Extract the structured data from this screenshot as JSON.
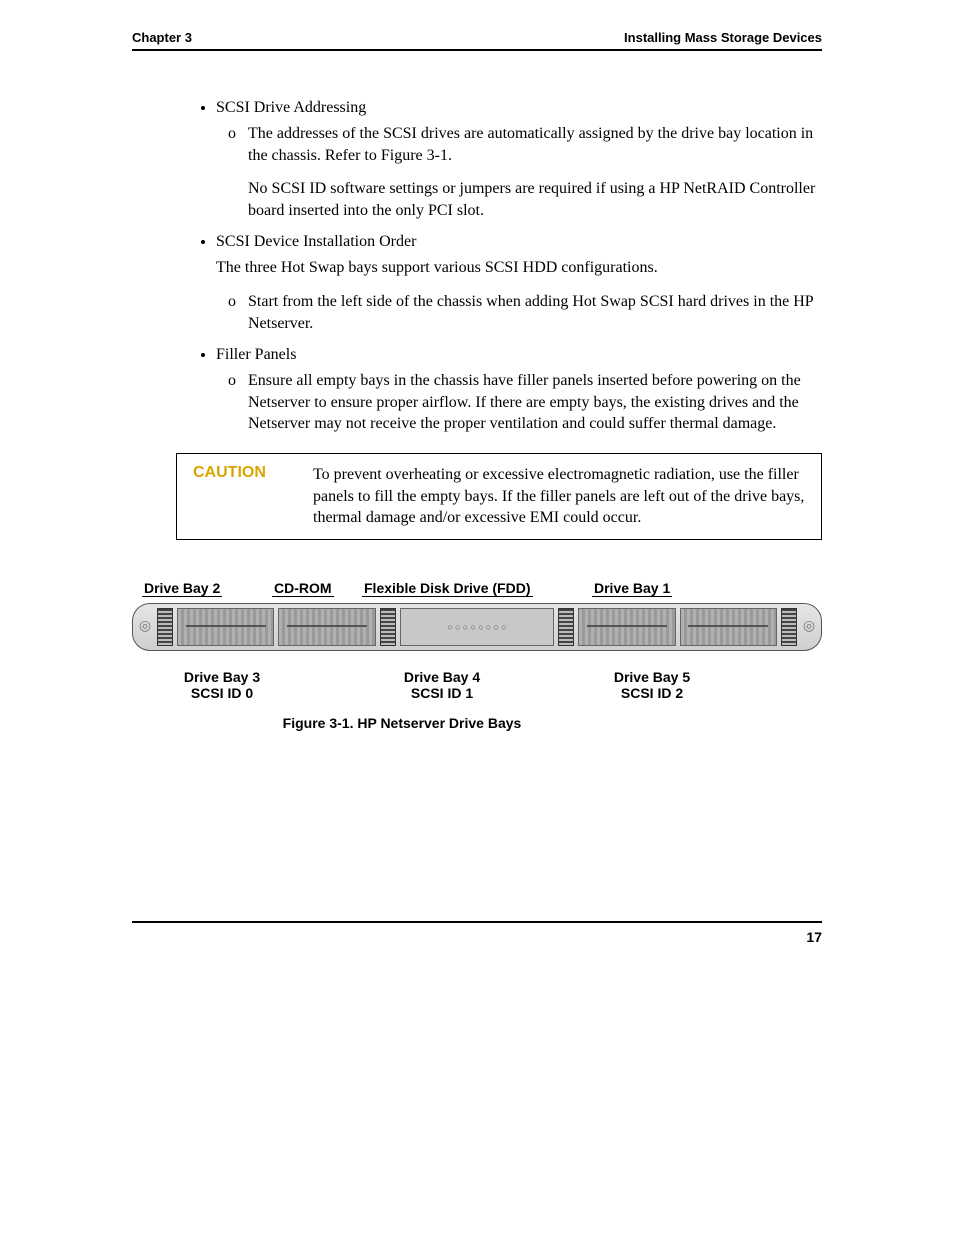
{
  "header": {
    "left": "Chapter 3",
    "right": "Installing Mass Storage Devices"
  },
  "list": {
    "item1": {
      "title": "SCSI Drive Addressing",
      "sub1": "The addresses of the SCSI drives are automatically assigned by the drive bay location in the chassis. Refer to Figure 3-1.",
      "note": "No SCSI ID software settings or jumpers are required if using a HP NetRAID Controller board inserted into the only PCI slot."
    },
    "item2": {
      "title": "SCSI Device Installation Order",
      "para": "The three Hot Swap bays support various SCSI HDD configurations.",
      "sub1": "Start from the left side of the chassis when adding Hot Swap SCSI hard drives in the HP Netserver."
    },
    "item3": {
      "title": "Filler Panels",
      "sub1": "Ensure all empty bays in the chassis have filler panels inserted before powering on the Netserver to ensure proper airflow. If there are empty bays, the existing drives and the Netserver may not receive the proper ventilation and could suffer thermal damage."
    }
  },
  "caution": {
    "label": "CAUTION",
    "text": "To prevent overheating or excessive electromagnetic radiation, use the filler panels to fill the empty bays. If the filler panels are left out of the drive bays, thermal damage and/or excessive EMI could occur."
  },
  "figure": {
    "top": {
      "bay2": "Drive Bay 2",
      "cdrom": "CD-ROM",
      "fdd": "Flexible Disk Drive (FDD)",
      "bay1": "Drive Bay 1"
    },
    "bottom": {
      "bay3_l1": "Drive Bay 3",
      "bay3_l2": "SCSI ID 0",
      "bay4_l1": "Drive Bay 4",
      "bay4_l2": "SCSI ID 1",
      "bay5_l1": "Drive Bay 5",
      "bay5_l2": "SCSI ID 2"
    },
    "caption": "Figure 3-1. HP Netserver Drive Bays"
  },
  "page_number": "17"
}
